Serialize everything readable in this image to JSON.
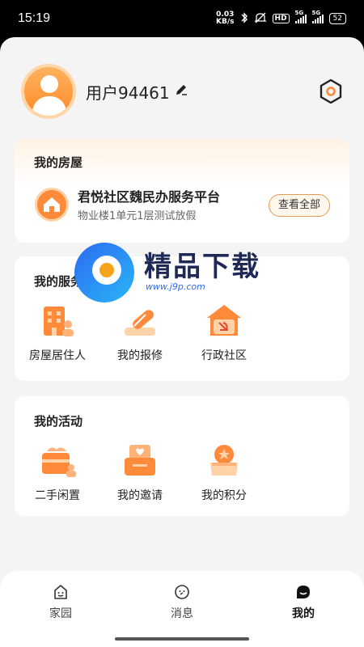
{
  "status_bar": {
    "time": "15:19",
    "net_speed_value": "0.03",
    "net_speed_unit": "KB/s",
    "hd_label": "HD",
    "sim1_label": "5G",
    "sim2_label": "5G",
    "battery": "52"
  },
  "profile": {
    "username": "用户94461"
  },
  "my_house": {
    "title": "我的房屋",
    "house_name": "君悦社区魏民办服务平台",
    "house_address": "物业楼1单元1层测试放假",
    "view_all_label": "查看全部"
  },
  "my_services": {
    "title": "我的服务",
    "items": [
      {
        "label": "房屋居住人",
        "icon": "building-icon"
      },
      {
        "label": "我的报修",
        "icon": "wrench-icon"
      },
      {
        "label": "行政社区",
        "icon": "party-house-icon"
      }
    ]
  },
  "my_activities": {
    "title": "我的活动",
    "items": [
      {
        "label": "二手闲置",
        "icon": "secondhand-icon"
      },
      {
        "label": "我的邀请",
        "icon": "invitation-icon"
      },
      {
        "label": "我的积分",
        "icon": "points-icon"
      }
    ]
  },
  "watermark": {
    "title": "精品下载",
    "url": "www.j9p.com"
  },
  "bottom_nav": {
    "tabs": [
      {
        "label": "家园",
        "icon": "home-face-icon"
      },
      {
        "label": "消息",
        "icon": "message-icon"
      },
      {
        "label": "我的",
        "icon": "profile-icon",
        "active": true
      }
    ]
  },
  "colors": {
    "accent": "#ff8a3a",
    "accent_light": "#ffd2a8",
    "background": "#f4f4f4"
  }
}
